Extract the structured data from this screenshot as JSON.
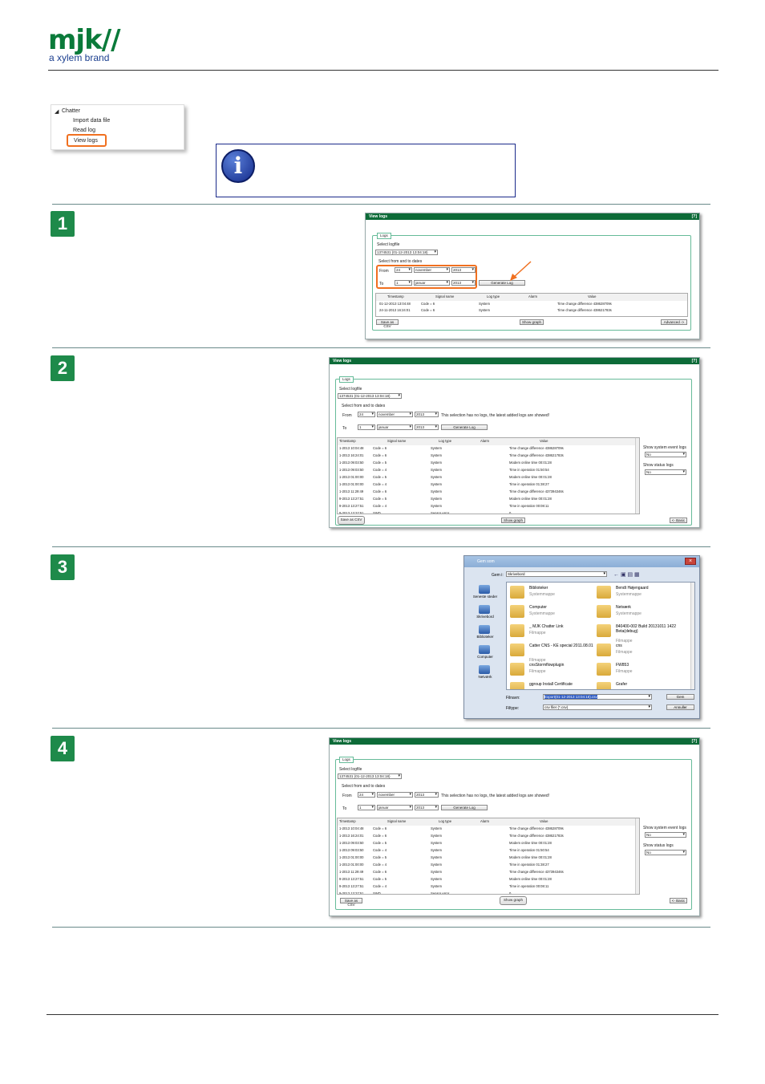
{
  "logo": {
    "brand": "mjk//",
    "tagline": "a xylem brand"
  },
  "menu": {
    "root": "Chatter",
    "items": [
      "Import data file",
      "Read log",
      "View logs"
    ]
  },
  "win": {
    "title": "View logs",
    "help": "[?]",
    "tab": "Logs",
    "select_logfile": "Select logfile",
    "logfile": "1374531 (01-12-2013 13:04:18)",
    "select_dates": "Select from and to dates",
    "from": "From",
    "to": "To",
    "from_day": "24",
    "from_month": "november",
    "from_year": "2013",
    "to_day": "1",
    "to_month": "januar",
    "to_year": "2013",
    "generate": "Generate Log",
    "nologs": "This selection has no logs, the latest added logs are showed!",
    "cols": [
      "Timestamp",
      "Signal name",
      "Log type",
      "Alarm",
      "Value"
    ],
    "save_csv": "Save as CSV",
    "show_graph": "Show graph",
    "advanced": "Advanced ->",
    "basic": "<- Basic",
    "show_sys": "Show system event logs",
    "show_status": "Show status logs",
    "no": "No"
  },
  "rows1": [
    [
      "01-12-2013 13:04:48",
      "Code = 6",
      "System",
      "",
      "Time change difference 438628709s"
    ],
    [
      "24-11-2013 16:24:01",
      "Code = 6",
      "System",
      "",
      "Time change difference 438621783s"
    ]
  ],
  "rows2": [
    [
      "1-2013 10:04:48",
      "Code = 6",
      "System",
      "",
      "Time change difference 438628709s"
    ],
    [
      "1-2013 16:24:01",
      "Code = 6",
      "System",
      "",
      "Time change difference 438621783s"
    ],
    [
      "1-2013 09:03:50",
      "Code = 5",
      "System",
      "",
      "Modem online time 00:01:28"
    ],
    [
      "1-2013 09:03:50",
      "Code = 4",
      "System",
      "",
      "Time in operation 01:50:54"
    ],
    [
      "1-2013 01:00:00",
      "Code = 5",
      "System",
      "",
      "Modem online time 00:01:28"
    ],
    [
      "1-2013 01:00:00",
      "Code = 4",
      "System",
      "",
      "Time in operation 01:38:27"
    ],
    [
      "1-2013 11:29:49",
      "Code = 6",
      "System",
      "",
      "Time change difference 437394346s"
    ],
    [
      "9-2013 13:27:51",
      "Code = 5",
      "System",
      "",
      "Modem online time 00:01:28"
    ],
    [
      "9-2013 13:27:51",
      "Code = 4",
      "System",
      "",
      "Time in operation 00:08:11"
    ],
    [
      "9-2013 13:27:51",
      "SWD",
      "Sensor error",
      "",
      "0"
    ]
  ],
  "dlg": {
    "title": "Gem som",
    "save_in_label": "Gem i:",
    "save_in": "Skrivebord",
    "places": [
      "Seneste steder",
      "Skrivebord",
      "Biblioteker",
      "Computer",
      "Netværk"
    ],
    "files": [
      {
        "n": "Biblioteker",
        "s": "Systemmappe"
      },
      {
        "n": "Bendt Højengaard",
        "s": "Systemmappe"
      },
      {
        "n": "Computer",
        "s": "Systemmappe"
      },
      {
        "n": "Netværk",
        "s": "Systemmappe"
      },
      {
        "n": "_ MJK Chatter Link",
        "s": "Filmappe"
      },
      {
        "n": "840400-002 Build 20131011 1422 Beta(debug)",
        "s": "Filmappe"
      },
      {
        "n": "Catter CNS - KE special 2011.08.01",
        "s": "Filmappe"
      },
      {
        "n": "cns",
        "s": "Filmappe"
      },
      {
        "n": "cnsStormflowplugin",
        "s": "Filmappe"
      },
      {
        "n": "FW853",
        "s": "Filmappe"
      },
      {
        "n": "ggroup Install Certificate",
        "s": ""
      },
      {
        "n": "Grafer",
        "s": ""
      }
    ],
    "filename_label": "Filnavn:",
    "filename": "Export(01-12-2013 13:04:18).csv",
    "filetype_label": "Filtype:",
    "filetype": "csv filer (*.csv)",
    "save": "Gem",
    "cancel": "Annuller"
  },
  "steps": [
    "1",
    "2",
    "3",
    "4"
  ]
}
